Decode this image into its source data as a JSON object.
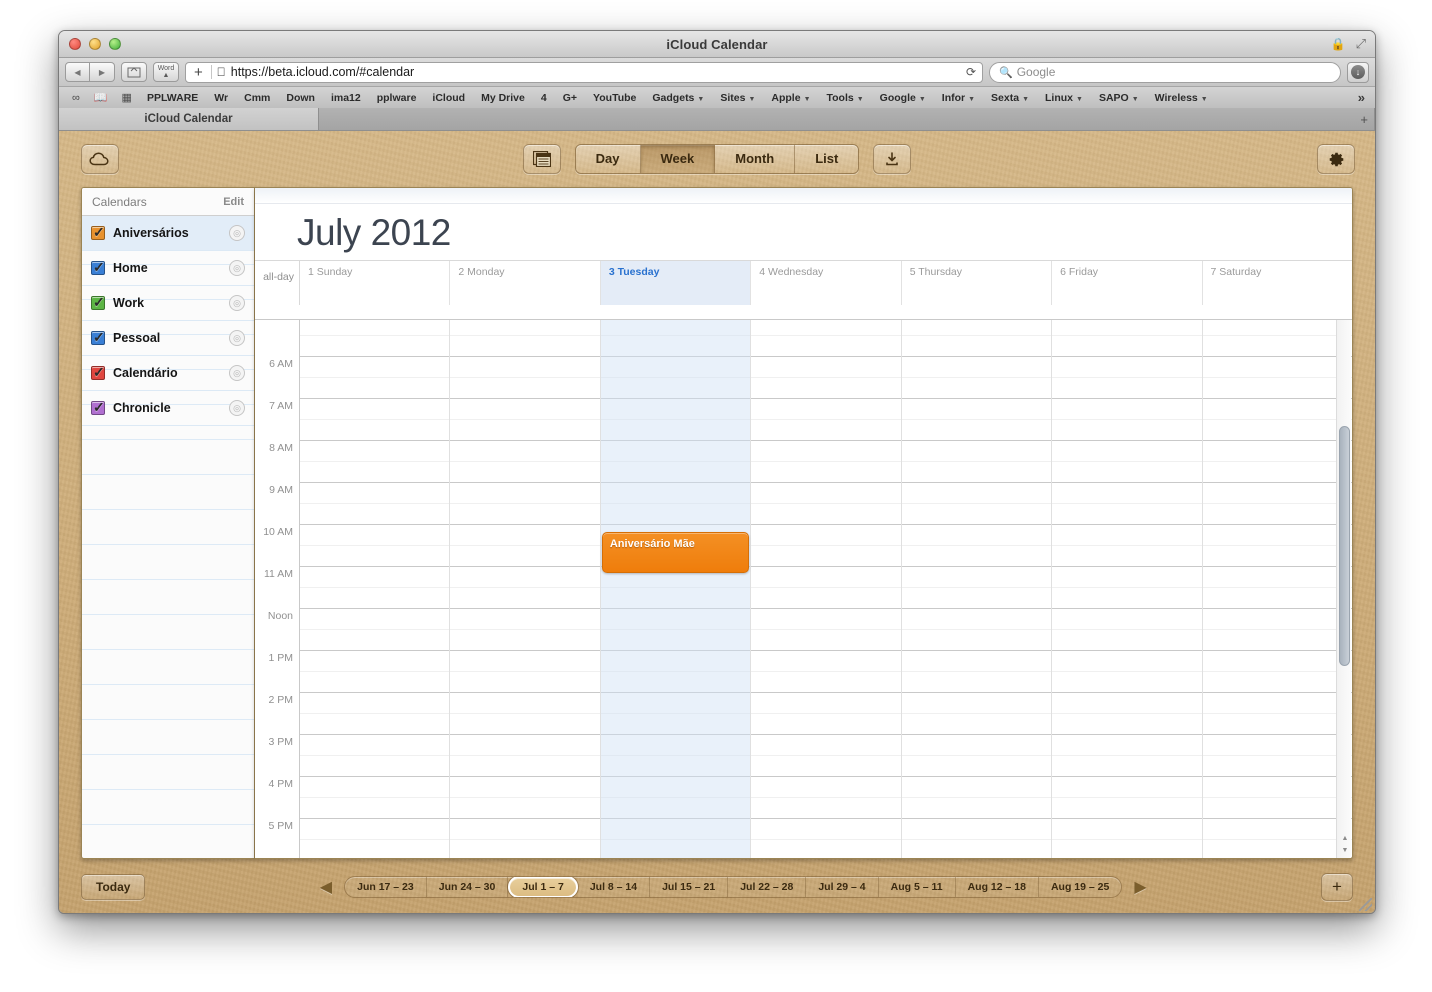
{
  "browser": {
    "window_title": "iCloud Calendar",
    "url": "https://beta.icloud.com/#calendar",
    "search_placeholder": "Google",
    "tab_label": "iCloud Calendar",
    "nav_back_icon": "◀",
    "nav_forward_icon": "▶",
    "reader_icon": "☐",
    "word_icon_label": "Word",
    "apple_icon": "",
    "plus_icon": "+",
    "reload_icon": "⟳",
    "search_icon": "⌕",
    "download_icon": "↓",
    "lock_icon": "🔒",
    "expand_icon": "⤢",
    "new_tab_icon": "+",
    "bookmark_icons": [
      "glasses-icon",
      "book-icon",
      "grid-icon"
    ],
    "bookmarks": [
      {
        "label": "PPLWARE",
        "menu": false
      },
      {
        "label": "Wr",
        "menu": false
      },
      {
        "label": "Cmm",
        "menu": false
      },
      {
        "label": "Down",
        "menu": false
      },
      {
        "label": "ima12",
        "menu": false
      },
      {
        "label": "pplware",
        "menu": false
      },
      {
        "label": "iCloud",
        "menu": false
      },
      {
        "label": "My Drive",
        "menu": false
      },
      {
        "label": "4",
        "menu": false
      },
      {
        "label": "G+",
        "menu": false
      },
      {
        "label": "YouTube",
        "menu": false
      },
      {
        "label": "Gadgets",
        "menu": true
      },
      {
        "label": "Sites",
        "menu": true
      },
      {
        "label": "Apple",
        "menu": true
      },
      {
        "label": "Tools",
        "menu": true
      },
      {
        "label": "Google",
        "menu": true
      },
      {
        "label": "Infor",
        "menu": true
      },
      {
        "label": "Sexta",
        "menu": true
      },
      {
        "label": "Linux",
        "menu": true
      },
      {
        "label": "SAPO",
        "menu": true
      },
      {
        "label": "Wireless",
        "menu": true
      }
    ],
    "bookmarks_overflow": "»"
  },
  "app": {
    "cloud_icon": "cloud-icon",
    "calendar_list_icon": "calendar-grid-icon",
    "share_icon": "share-icon",
    "gear_icon": "gear-icon",
    "views": [
      {
        "label": "Day",
        "active": false
      },
      {
        "label": "Week",
        "active": true
      },
      {
        "label": "Month",
        "active": false
      },
      {
        "label": "List",
        "active": false
      }
    ]
  },
  "sidebar": {
    "title": "Calendars",
    "edit_label": "Edit",
    "calendars": [
      {
        "name": "Aniversários",
        "color": "#e8922e",
        "selected": true
      },
      {
        "name": "Home",
        "color": "#3a7fd5",
        "selected": false
      },
      {
        "name": "Work",
        "color": "#5cb544",
        "selected": false
      },
      {
        "name": "Pessoal",
        "color": "#3a7fd5",
        "selected": false
      },
      {
        "name": "Calendário",
        "color": "#e0463f",
        "selected": false
      },
      {
        "name": "Chronicle",
        "color": "#b06fd0",
        "selected": false
      }
    ],
    "empty_row_count": 12
  },
  "calendar": {
    "title": "July 2012",
    "allday_label": "all-day",
    "days": [
      {
        "label": "1 Sunday",
        "today": false
      },
      {
        "label": "2 Monday",
        "today": false
      },
      {
        "label": "3 Tuesday",
        "today": true
      },
      {
        "label": "4 Wednesday",
        "today": false
      },
      {
        "label": "5 Thursday",
        "today": false
      },
      {
        "label": "6 Friday",
        "today": false
      },
      {
        "label": "7 Saturday",
        "today": false
      }
    ],
    "hours": [
      "6 AM",
      "7 AM",
      "8 AM",
      "9 AM",
      "10 AM",
      "11 AM",
      "Noon",
      "1 PM",
      "2 PM",
      "3 PM",
      "4 PM",
      "5 PM"
    ],
    "events": [
      {
        "title": "Aniversário Mãe",
        "day_index": 2,
        "start": "10 AM",
        "end": "11 AM",
        "color": "#ef7d0b"
      }
    ],
    "scroll_up_icon": "▲",
    "scroll_down_icon": "▼"
  },
  "bottom": {
    "today_label": "Today",
    "prev_icon": "◀",
    "next_icon": "▶",
    "add_icon": "+",
    "weeks": [
      {
        "label": "Jun 17 – 23",
        "current": false
      },
      {
        "label": "Jun 24 – 30",
        "current": false
      },
      {
        "label": "Jul 1 – 7",
        "current": true
      },
      {
        "label": "Jul 8 – 14",
        "current": false
      },
      {
        "label": "Jul 15 – 21",
        "current": false
      },
      {
        "label": "Jul 22 – 28",
        "current": false
      },
      {
        "label": "Jul 29 – 4",
        "current": false
      },
      {
        "label": "Aug 5 – 11",
        "current": false
      },
      {
        "label": "Aug 12 – 18",
        "current": false
      },
      {
        "label": "Aug 19 – 25",
        "current": false
      }
    ]
  }
}
